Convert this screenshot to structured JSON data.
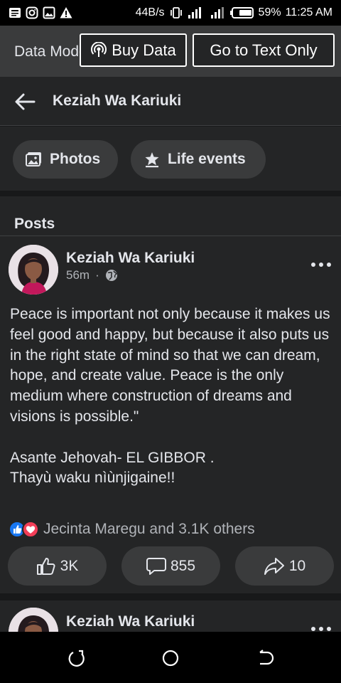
{
  "status_bar": {
    "speed": "44B/s",
    "battery": "59%",
    "time": "11:25 AM"
  },
  "data_banner": {
    "label": "Data Mode",
    "buy_data": "Buy Data",
    "text_only": "Go to Text Only"
  },
  "header": {
    "title": "Keziah Wa Kariuki"
  },
  "pills": [
    {
      "label": "Photos",
      "icon": "photos-icon"
    },
    {
      "label": "Life events",
      "icon": "life-events-icon"
    }
  ],
  "posts_section": {
    "title": "Posts"
  },
  "post": {
    "author": "Keziah Wa Kariuki",
    "time": "56m",
    "audience_icon": "globe-icon",
    "body": "Peace is important not only because it makes us feel good and happy, but because it also puts us in the right state of mind so that we can dream, hope, and create value. Peace is the only medium where construction of dreams and visions is possible.\"\n\nAsante Jehovah- EL GIBBOR .\nThayù waku nìùnjigaine!!",
    "reactions_text": "Jecinta Maregu and 3.1K others",
    "likes": "3K",
    "comments": "855",
    "shares": "10"
  },
  "post2": {
    "author": "Keziah Wa Kariuki"
  },
  "colors": {
    "background": "#18191a",
    "card": "#242526",
    "pill": "#3a3b3c",
    "text": "#e4e6eb",
    "muted": "#b0b3b8",
    "like_blue": "#1877f2",
    "love_red": "#f33e58"
  }
}
